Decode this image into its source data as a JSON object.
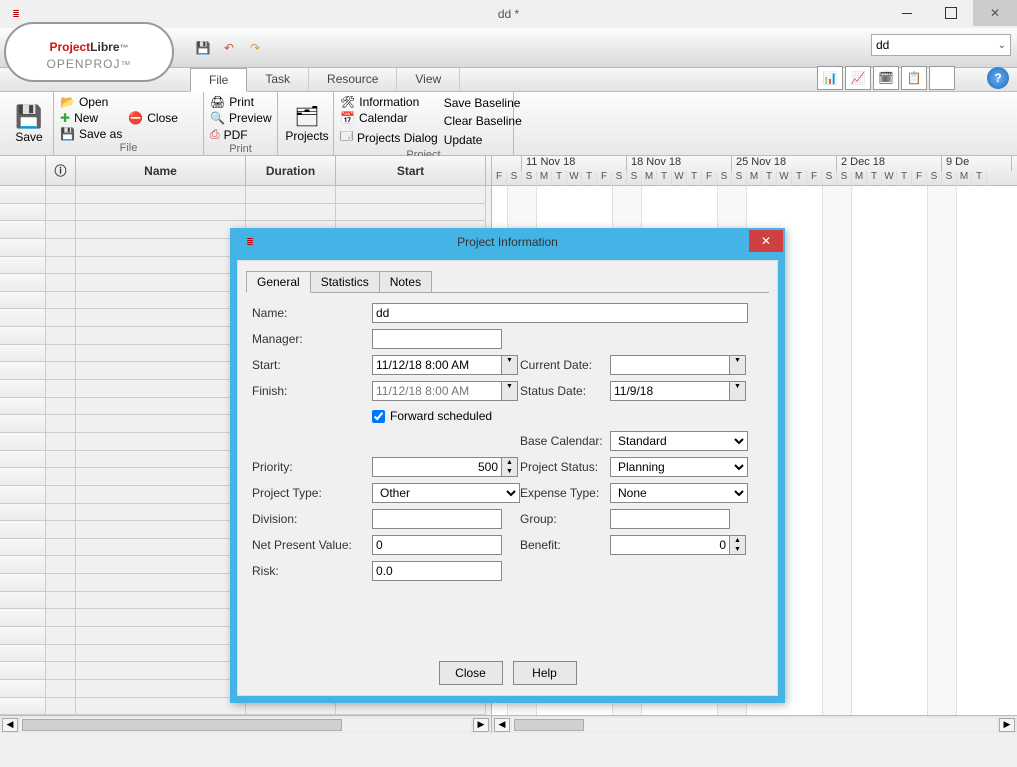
{
  "window": {
    "title": "dd *"
  },
  "brand": {
    "part1": "Project",
    "part2": "Libre",
    "tm": "™",
    "sub": "OPENPROJ"
  },
  "top_selector": {
    "value": "dd"
  },
  "tabs": {
    "file": "File",
    "task": "Task",
    "resource": "Resource",
    "view": "View"
  },
  "ribbon": {
    "save": "Save",
    "open": "Open",
    "new": "New",
    "saveas": "Save as",
    "close": "Close",
    "group_file": "File",
    "print": "Print",
    "preview": "Preview",
    "pdf": "PDF",
    "group_print": "Print",
    "projects": "Projects",
    "information": "Information",
    "calendar": "Calendar",
    "projects_dialog": "Projects Dialog",
    "save_baseline": "Save Baseline",
    "clear_baseline": "Clear Baseline",
    "update": "Update",
    "group_project": "Project"
  },
  "grid": {
    "name": "Name",
    "duration": "Duration",
    "start": "Start",
    "info_icon": "ⓘ"
  },
  "gantt": {
    "dates": [
      "11 Nov 18",
      "18 Nov 18",
      "25 Nov 18",
      "2 Dec 18",
      "9 De"
    ],
    "days": [
      "F",
      "S",
      "S",
      "M",
      "T",
      "W",
      "T",
      "F",
      "S",
      "S",
      "M",
      "T",
      "W",
      "T",
      "F",
      "S",
      "S",
      "M",
      "T",
      "W",
      "T",
      "F",
      "S",
      "S",
      "M",
      "T",
      "W",
      "T",
      "F",
      "S",
      "S",
      "M",
      "T"
    ]
  },
  "dialog": {
    "title": "Project Information",
    "tabs": {
      "general": "General",
      "statistics": "Statistics",
      "notes": "Notes"
    },
    "labels": {
      "name": "Name:",
      "manager": "Manager:",
      "start": "Start:",
      "finish": "Finish:",
      "forward": "Forward scheduled",
      "priority": "Priority:",
      "project_type": "Project Type:",
      "division": "Division:",
      "npv": "Net Present Value:",
      "risk": "Risk:",
      "current_date": "Current Date:",
      "status_date": "Status Date:",
      "base_cal": "Base Calendar:",
      "project_status": "Project Status:",
      "expense_type": "Expense Type:",
      "group": "Group:",
      "benefit": "Benefit:"
    },
    "values": {
      "name": "dd",
      "manager": "",
      "start": "11/12/18 8:00 AM",
      "finish": "11/12/18 8:00 AM",
      "forward": true,
      "priority": "500",
      "project_type": "Other",
      "division": "",
      "npv": "0",
      "risk": "0.0",
      "current_date": "",
      "status_date": "11/9/18",
      "base_cal": "Standard",
      "project_status": "Planning",
      "expense_type": "None",
      "group": "",
      "benefit": "0"
    },
    "buttons": {
      "close": "Close",
      "help": "Help"
    }
  },
  "help_icon": "?"
}
